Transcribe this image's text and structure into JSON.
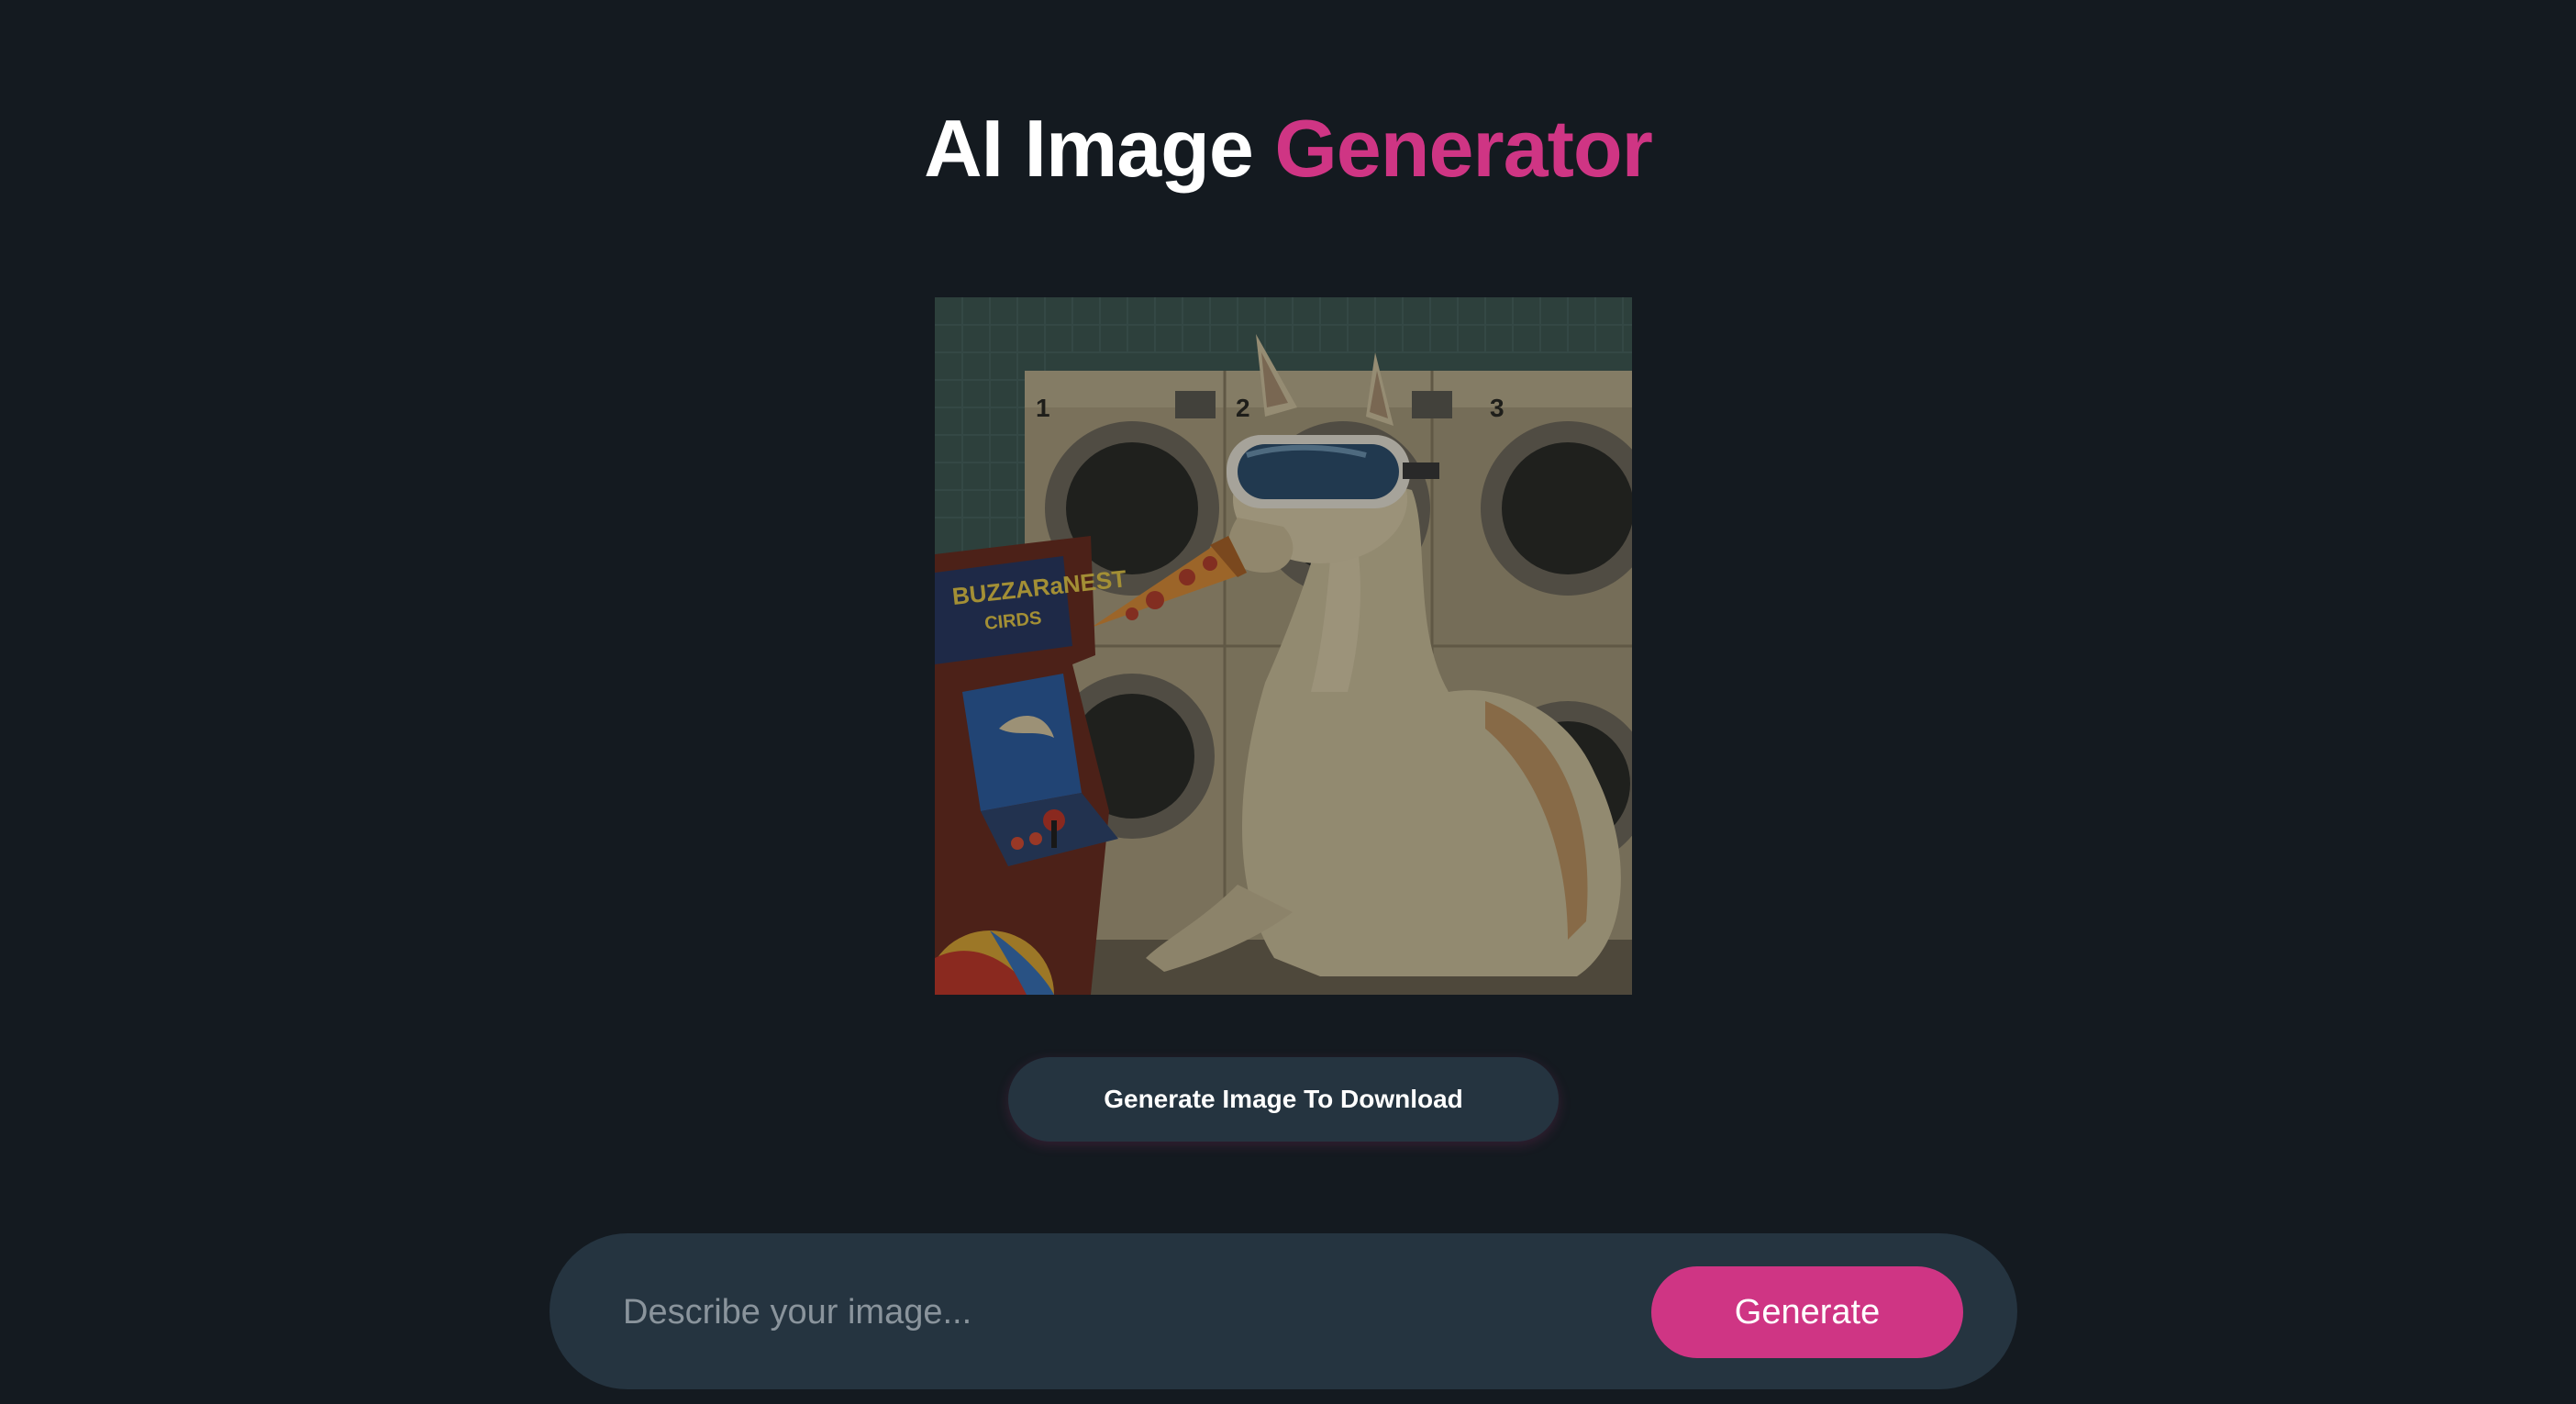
{
  "header": {
    "title_part1": "AI Image",
    "title_part2": "Generator"
  },
  "preview": {
    "image_alt": "Llama wearing goggles eating pizza in a laundromat next to an arcade cabinet",
    "arcade_sign_line1": "BUZZARaNEST",
    "arcade_sign_line2": "CIRDS",
    "washer_numbers": [
      "1",
      "2",
      "3"
    ]
  },
  "download_button": {
    "label": "Generate Image To Download"
  },
  "prompt": {
    "placeholder": "Describe your image...",
    "value": "",
    "generate_label": "Generate"
  },
  "colors": {
    "background": "#141a20",
    "accent": "#cf3584",
    "surface": "#253440",
    "text": "#ffffff",
    "placeholder": "#8a949c"
  }
}
